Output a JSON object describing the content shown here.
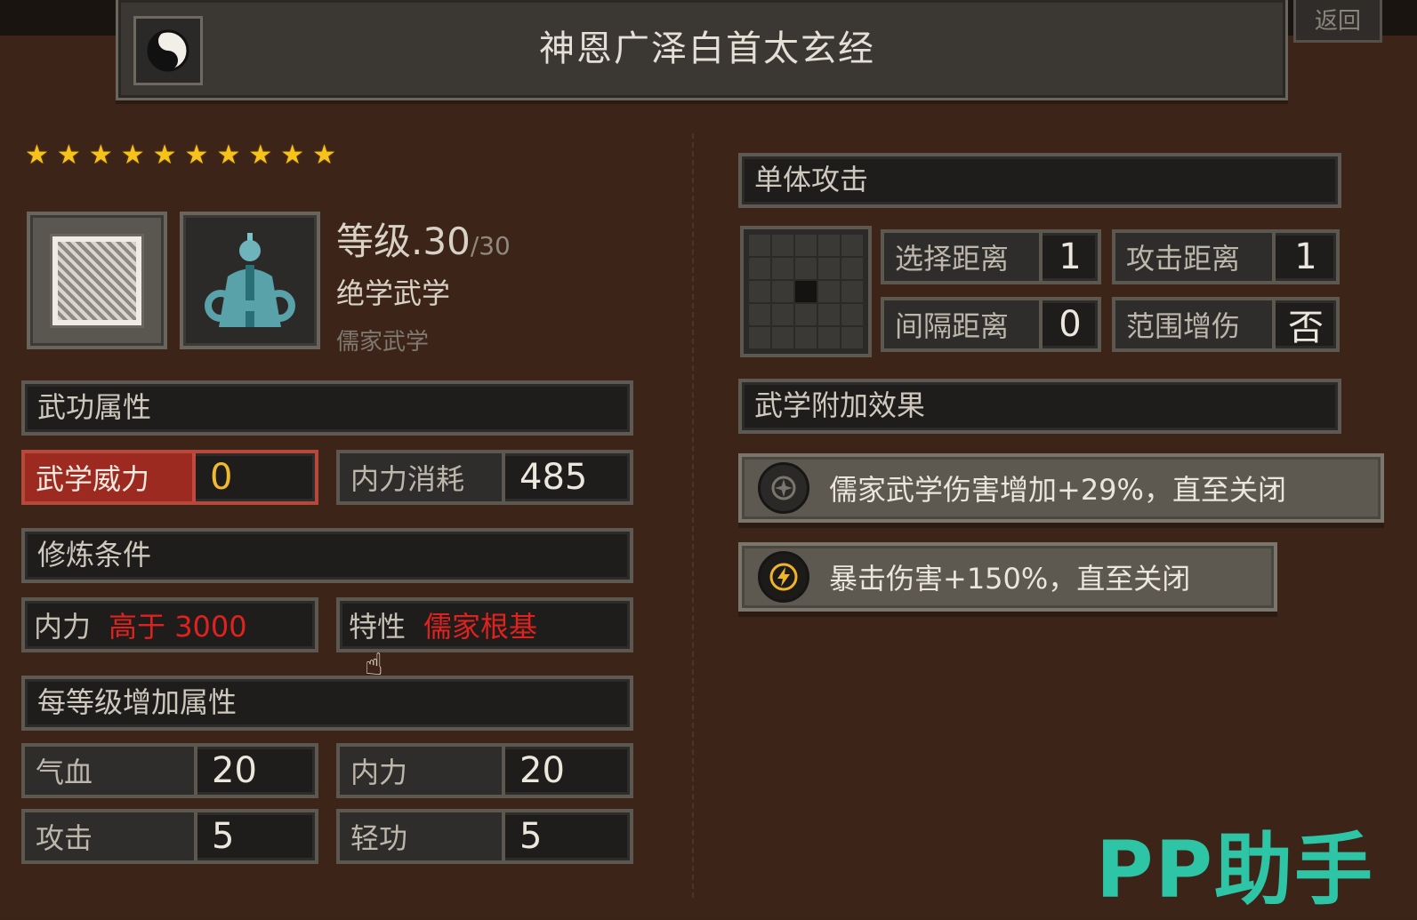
{
  "header": {
    "title": "神恩广泽白首太玄经",
    "return_label": "返回"
  },
  "skill": {
    "stars": 10,
    "level_label": "等级",
    "level": ".30",
    "level_max": "/30",
    "category": "绝学武学",
    "school": "儒家武学"
  },
  "attributes": {
    "header": "武功属性",
    "power_label": "武学威力",
    "power_value": "0",
    "cost_label": "内力消耗",
    "cost_value": "485"
  },
  "requirements": {
    "header": "修炼条件",
    "req1_label": "内力",
    "req1_value": "高于 3000",
    "req2_label": "特性",
    "req2_value": "儒家根基"
  },
  "per_level": {
    "header": "每等级增加属性",
    "stats": [
      {
        "label": "气血",
        "value": "20"
      },
      {
        "label": "内力",
        "value": "20"
      },
      {
        "label": "攻击",
        "value": "5"
      },
      {
        "label": "轻功",
        "value": "5"
      }
    ]
  },
  "attack": {
    "header": "单体攻击",
    "select_range_label": "选择距离",
    "select_range_value": "1",
    "attack_range_label": "攻击距离",
    "attack_range_value": "1",
    "interval_label": "间隔距离",
    "interval_value": "0",
    "aoe_label": "范围增伤",
    "aoe_value": "否"
  },
  "effects": {
    "header": "武学附加效果",
    "items": [
      {
        "text": "儒家武学伤害增加+29%，直至关闭",
        "icon": "compass-icon"
      },
      {
        "text": "暴击伤害+150%，直至关闭",
        "icon": "lightning-icon"
      }
    ]
  },
  "watermark": "PP助手",
  "colors": {
    "background": "#3d2419",
    "star": "#f6c21c",
    "requirement_red": "#e0221e",
    "power_label_bg": "#9c2a21",
    "watermark": "#2ec4a6"
  }
}
